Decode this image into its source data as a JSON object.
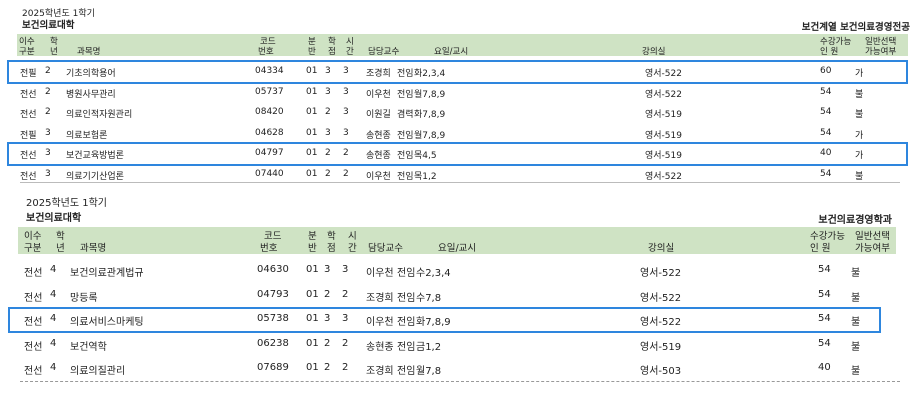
{
  "section1": {
    "term": "2025학년도 1학기",
    "college": "보건의료대학",
    "department": "보건계열  보건의료경영전공",
    "headers": {
      "type": [
        "이수",
        "구분"
      ],
      "year": [
        "학",
        "년"
      ],
      "course": "과목명",
      "code": [
        "코드",
        "번호"
      ],
      "section": [
        "분",
        "반"
      ],
      "credit": [
        "학",
        "점"
      ],
      "hours": [
        "시",
        "간"
      ],
      "professor": "담당교수",
      "schedule": "요일/교시",
      "room": "강의실",
      "capacity": [
        "수강가능",
        "인      원"
      ],
      "general": [
        "일반선택",
        "가능여부"
      ]
    },
    "rows": [
      {
        "type": "전필",
        "year": "2",
        "course": "기초의학용어",
        "code": "04334",
        "section": "01",
        "credit": "3",
        "hours": "3",
        "professor": "조경희",
        "status": "전임",
        "schedule": "화2,3,4",
        "room": "영서-522",
        "capacity": "60",
        "general": "가",
        "highlight": true
      },
      {
        "type": "전선",
        "year": "2",
        "course": "병원사무관리",
        "code": "05737",
        "section": "01",
        "credit": "3",
        "hours": "3",
        "professor": "이우천",
        "status": "전임",
        "schedule": "월7,8,9",
        "room": "영서-522",
        "capacity": "54",
        "general": "불",
        "highlight": false
      },
      {
        "type": "전선",
        "year": "2",
        "course": "의료인적자원관리",
        "code": "08420",
        "section": "01",
        "credit": "2",
        "hours": "3",
        "professor": "이원길",
        "status": "겸력",
        "schedule": "화7,8,9",
        "room": "영서-519",
        "capacity": "54",
        "general": "불",
        "highlight": false
      },
      {
        "type": "전필",
        "year": "3",
        "course": "의료보험론",
        "code": "04628",
        "section": "01",
        "credit": "3",
        "hours": "3",
        "professor": "송현종",
        "status": "전임",
        "schedule": "월7,8,9",
        "room": "영서-519",
        "capacity": "54",
        "general": "가",
        "highlight": false
      },
      {
        "type": "전선",
        "year": "3",
        "course": "보건교육방법론",
        "code": "04797",
        "section": "01",
        "credit": "2",
        "hours": "2",
        "professor": "송현종",
        "status": "전임",
        "schedule": "목4,5",
        "room": "영서-519",
        "capacity": "40",
        "general": "가",
        "highlight": true
      },
      {
        "type": "전선",
        "year": "3",
        "course": "의료기기산업론",
        "code": "07440",
        "section": "01",
        "credit": "2",
        "hours": "2",
        "professor": "이우천",
        "status": "전임",
        "schedule": "목1,2",
        "room": "영서-522",
        "capacity": "54",
        "general": "불",
        "highlight": false
      }
    ]
  },
  "section2": {
    "term": "2025학년도 1학기",
    "college": "보건의료대학",
    "department": "보건의료경영학과",
    "headers": {
      "type": [
        "이수",
        "구분"
      ],
      "year": [
        "학",
        "년"
      ],
      "course": "과목명",
      "code": [
        "코드",
        "번호"
      ],
      "section": [
        "분",
        "반"
      ],
      "credit": [
        "학",
        "점"
      ],
      "hours": [
        "시",
        "간"
      ],
      "professor": "담당교수",
      "schedule": "요일/교시",
      "room": "강의실",
      "capacity": [
        "수강가능",
        "인      원"
      ],
      "general": [
        "일반선택",
        "가능여부"
      ]
    },
    "rows": [
      {
        "type": "전선",
        "year": "4",
        "course": "보건의료관계법규",
        "code": "04630",
        "section": "01",
        "credit": "3",
        "hours": "3",
        "professor": "이우천",
        "status": "전임",
        "schedule": "수2,3,4",
        "room": "영서-522",
        "capacity": "54",
        "general": "불",
        "highlight": false
      },
      {
        "type": "전선",
        "year": "4",
        "course": "망등록",
        "code": "04793",
        "section": "01",
        "credit": "2",
        "hours": "2",
        "professor": "조경희",
        "status": "전임",
        "schedule": "수7,8",
        "room": "영서-522",
        "capacity": "54",
        "general": "불",
        "highlight": false
      },
      {
        "type": "전선",
        "year": "4",
        "course": "의료서비스마케팅",
        "code": "05738",
        "section": "01",
        "credit": "3",
        "hours": "3",
        "professor": "이우천",
        "status": "전임",
        "schedule": "화7,8,9",
        "room": "영서-522",
        "capacity": "54",
        "general": "불",
        "highlight": true
      },
      {
        "type": "전선",
        "year": "4",
        "course": "보건역학",
        "code": "06238",
        "section": "01",
        "credit": "2",
        "hours": "2",
        "professor": "송현종",
        "status": "전임",
        "schedule": "금1,2",
        "room": "영서-519",
        "capacity": "54",
        "general": "불",
        "highlight": false
      },
      {
        "type": "전선",
        "year": "4",
        "course": "의료의질관리",
        "code": "07689",
        "section": "01",
        "credit": "2",
        "hours": "2",
        "professor": "조경희",
        "status": "전임",
        "schedule": "월7,8",
        "room": "영서-503",
        "capacity": "40",
        "general": "불",
        "highlight": false
      }
    ]
  },
  "colors": {
    "header_bg": "#cfe3c4",
    "highlight_border": "#2e86de"
  }
}
